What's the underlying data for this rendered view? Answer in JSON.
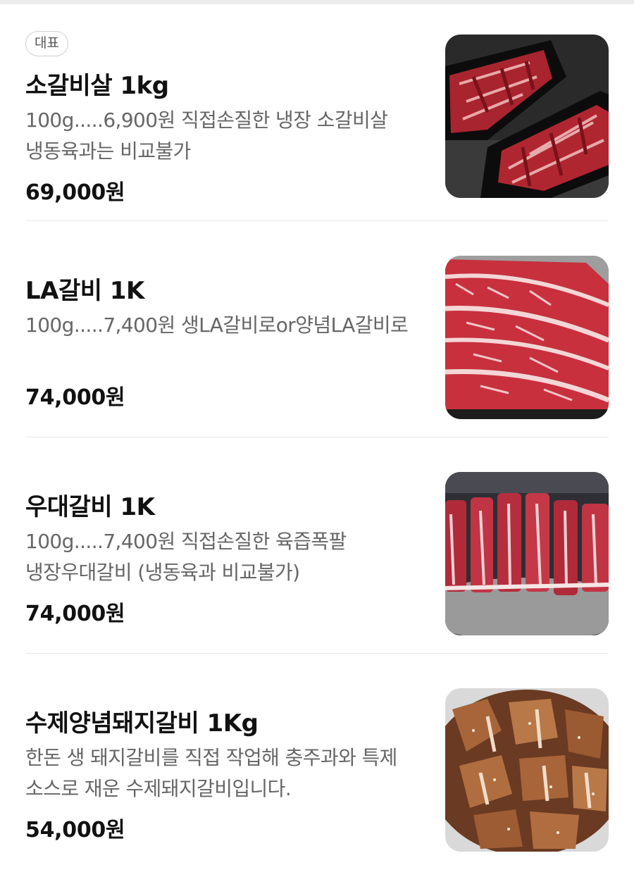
{
  "menu": {
    "items": [
      {
        "badge": "대표",
        "name": "소갈비살 1kg",
        "description": "100g.....6,900원 직접손질한 냉장 소갈비살 냉동육과는 비교불가",
        "price": "69,000원",
        "photo": "beef-rib-finger-meat-on-black-plates"
      },
      {
        "badge": "",
        "name": "LA갈비 1K",
        "description": "100g.....7,400원 생LA갈비로or양념LA갈비로",
        "price": "74,000원",
        "photo": "raw-la-galbi-slices"
      },
      {
        "badge": "",
        "name": "우대갈비 1K",
        "description": "100g.....7,400원 직접손질한 육즙폭팔 냉장우대갈비 (냉동육과 비교불가)",
        "price": "74,000원",
        "photo": "raw-beef-short-ribs-on-tray"
      },
      {
        "badge": "",
        "name": "수제양념돼지갈비 1Kg",
        "description": "한돈 생 돼지갈비를 직접 작업해 충주과와 특제 소스로 재운 수제돼지갈비입니다.",
        "price": "54,000원",
        "photo": "marinated-pork-ribs-with-sesame"
      }
    ]
  },
  "colors": {
    "text_primary": "#111111",
    "text_secondary": "#666666",
    "divider": "#e9e9e9",
    "badge_border": "#cfcfcf"
  }
}
